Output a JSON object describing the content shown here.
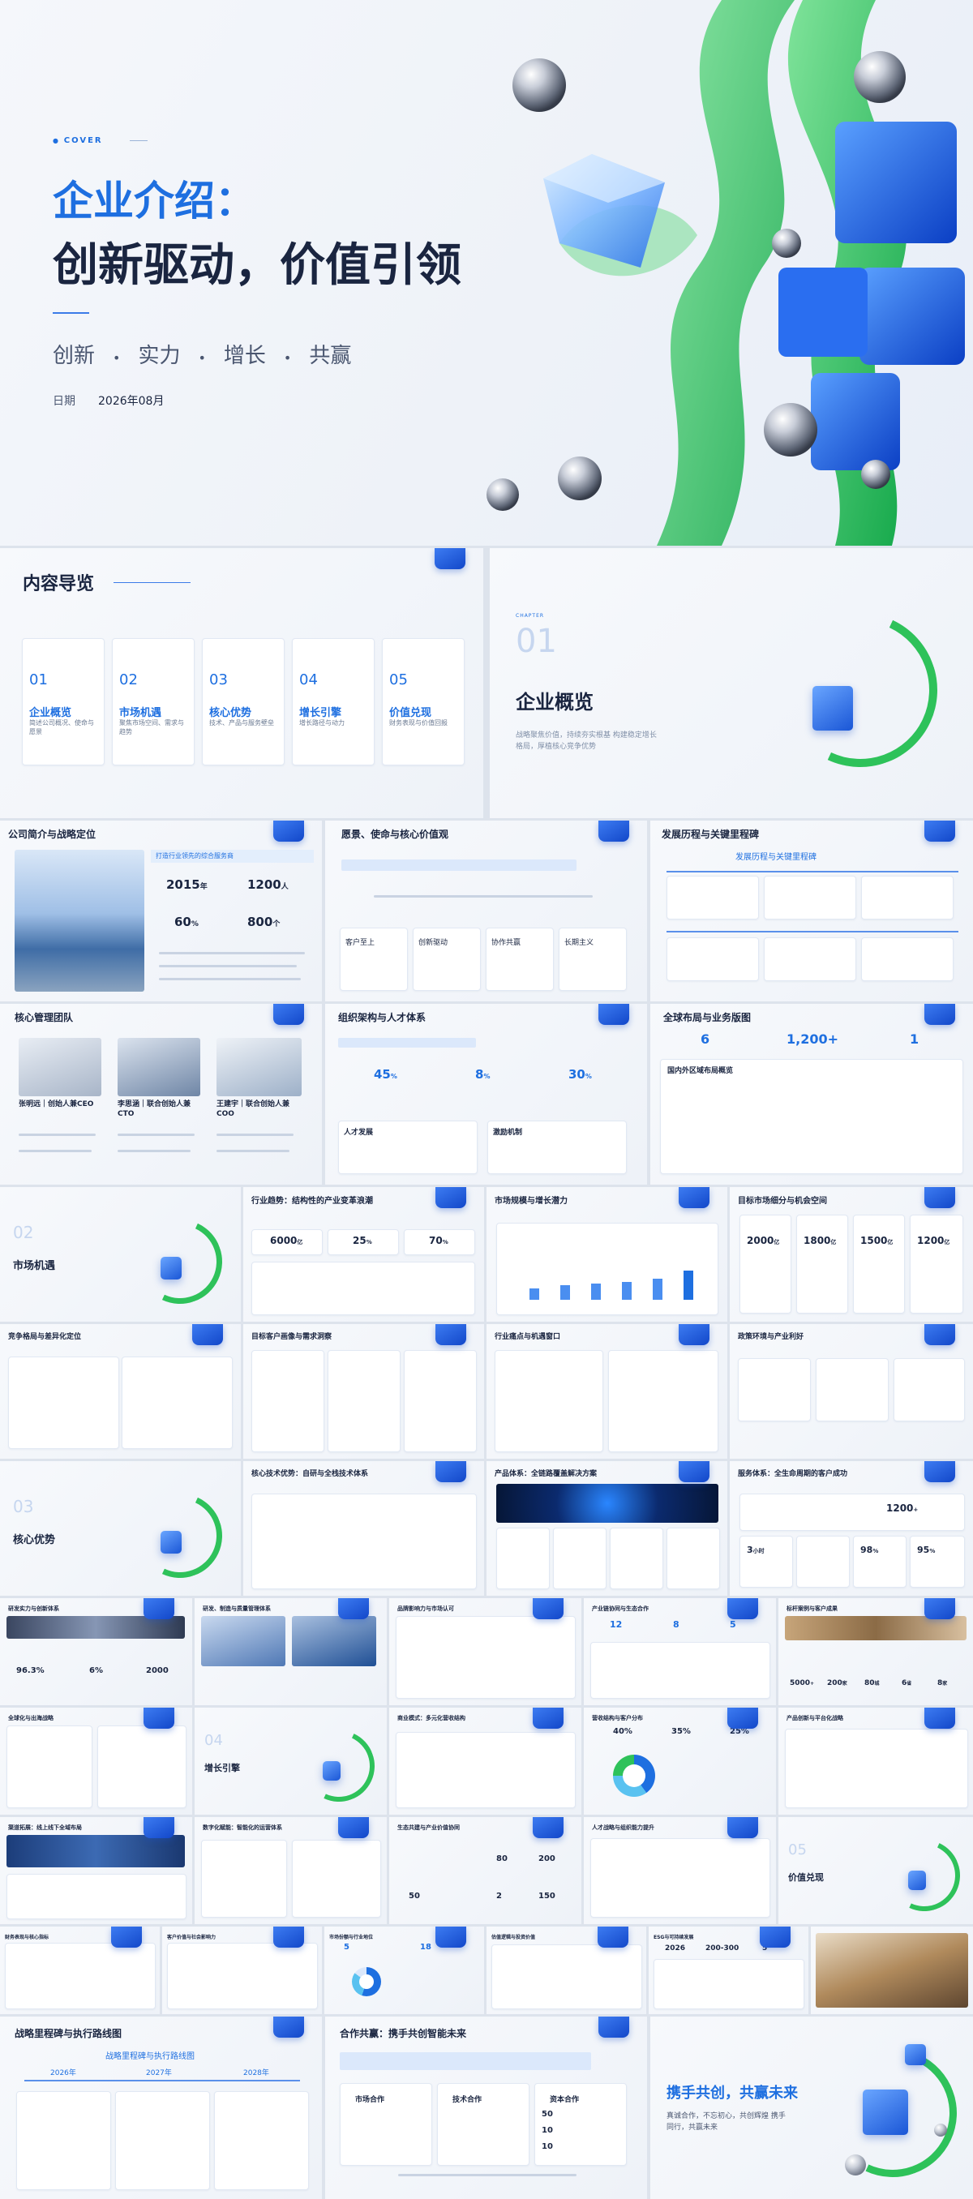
{
  "cover": {
    "tag": "COVER",
    "title_line1": "企业介绍：",
    "title_line2": "创新驱动，价值引领",
    "keywords": [
      "创新",
      "实力",
      "增长",
      "共赢"
    ],
    "separator": "•",
    "date_label": "日期",
    "date_value": "2026年08月"
  },
  "toc": {
    "title": "内容导览",
    "items": [
      {
        "num": "01",
        "title": "企业概览",
        "desc": "简述公司概况、使命与愿景"
      },
      {
        "num": "02",
        "title": "市场机遇",
        "desc": "聚焦市场空间、需求与趋势"
      },
      {
        "num": "03",
        "title": "核心优势",
        "desc": "技术、产品与服务壁垒"
      },
      {
        "num": "04",
        "title": "增长引擎",
        "desc": "增长路径与动力"
      },
      {
        "num": "05",
        "title": "价值兑现",
        "desc": "财务表现与价值回报"
      }
    ]
  },
  "chapter01": {
    "tag": "CHAPTER",
    "num": "01",
    "title": "企业概览",
    "desc": "战略聚焦价值，持续夯实根基 构建稳定增长格局，厚植核心竞争优势"
  },
  "row1": {
    "s1": {
      "title": "公司简介与战略定位",
      "banner": "打造行业领先的综合服务商",
      "stats": [
        {
          "v": "2015",
          "u": "年"
        },
        {
          "v": "1200",
          "u": "人"
        },
        {
          "v": "60",
          "u": "%"
        },
        {
          "v": "800",
          "u": "个"
        }
      ]
    },
    "s2": {
      "title": "愿景、使命与核心价值观",
      "values": [
        "客户至上",
        "创新驱动",
        "协作共赢",
        "长期主义"
      ]
    },
    "s3": {
      "title": "发展历程与关键里程碑",
      "subtitle": "发展历程与关键里程碑"
    }
  },
  "row2": {
    "s1": {
      "title": "核心管理团队",
      "people": [
        {
          "name": "张明远｜创始人兼CEO"
        },
        {
          "name": "李思涵｜联合创始人兼CTO"
        },
        {
          "name": "王建宇｜联合创始人兼COO"
        }
      ]
    },
    "s2": {
      "title": "组织架构与人才体系",
      "stats": [
        {
          "v": "45",
          "u": "%"
        },
        {
          "v": "8",
          "u": "%"
        },
        {
          "v": "30",
          "u": "%"
        }
      ],
      "sub": [
        "人才发展",
        "激励机制"
      ]
    },
    "s3": {
      "title": "全球布局与业务版图",
      "stats": [
        {
          "v": "6"
        },
        {
          "v": "1,200+"
        },
        {
          "v": "1"
        }
      ],
      "sub": "国内外区域布局概览"
    }
  },
  "chapter02": {
    "num": "02",
    "title": "市场机遇"
  },
  "row3": {
    "s2": {
      "title": "行业趋势：结构性的产业变革浪潮",
      "stats": [
        {
          "v": "6000",
          "u": "亿"
        },
        {
          "v": "25",
          "u": "%"
        },
        {
          "v": "70",
          "u": "%"
        }
      ]
    },
    "s3": {
      "title": "市场规模与增长潜力"
    },
    "s4": {
      "title": "目标市场细分与机会空间",
      "stats": [
        {
          "v": "2000",
          "u": "亿"
        },
        {
          "v": "1800",
          "u": "亿"
        },
        {
          "v": "1500",
          "u": "亿"
        },
        {
          "v": "1200",
          "u": "亿"
        }
      ]
    }
  },
  "row4": {
    "s1": {
      "title": "竞争格局与差异化定位"
    },
    "s2": {
      "title": "目标客户画像与需求洞察"
    },
    "s3": {
      "title": "行业痛点与机遇窗口"
    },
    "s4": {
      "title": "政策环境与产业利好"
    }
  },
  "chapter03": {
    "num": "03",
    "title": "核心优势"
  },
  "row5": {
    "s2": {
      "title": "核心技术优势：自研与全栈技术体系"
    },
    "s3": {
      "title": "产品体系：全链路覆盖解决方案"
    },
    "s4": {
      "title": "服务体系：全生命周期的客户成功",
      "stats": [
        {
          "v": "1200",
          "u": "+"
        },
        {
          "v": "3",
          "u": "小时"
        },
        {
          "v": "98",
          "u": "%"
        },
        {
          "v": "95",
          "u": "%"
        }
      ]
    }
  },
  "row6": {
    "titles": [
      "研发实力与创新体系",
      "研发、制造与质量管理体系",
      "品牌影响力与市场认可",
      "产业链协同与生态合作",
      "标杆案例与客户成果"
    ],
    "stats_a": [
      "96.3%",
      "6%",
      "2000"
    ],
    "stats_d": [
      "12",
      "8",
      "5"
    ],
    "stats_e": [
      "5000",
      "200",
      "80",
      "6",
      "8"
    ],
    "suffix_e": [
      "+",
      "家",
      "城",
      "省",
      "家"
    ]
  },
  "chapter04": {
    "num": "04",
    "title": "增长引擎"
  },
  "row7": {
    "titles": [
      "全球化与出海战略",
      "",
      "商业模式：多元化营收结构",
      "营收结构与客户分布",
      "产品创新与平台化战略"
    ],
    "stats_d": [
      "40%",
      "35%",
      "25%"
    ]
  },
  "row8": {
    "titles": [
      "渠道拓展：线上线下全域布局",
      "数字化赋能：智能化的运营体系",
      "生态共建与产业价值协同",
      "人才战略与组织能力提升"
    ],
    "stats_c": [
      "80",
      "200",
      "50",
      "2",
      "150"
    ],
    "chapter05": {
      "num": "05",
      "title": "价值兑现"
    }
  },
  "row9": {
    "titles": [
      "财务表现与核心指标",
      "客户价值与社会影响力",
      "市场份额与行业地位",
      "估值逻辑与投资价值",
      "ESG与可持续发展",
      ""
    ],
    "stats": [
      "5",
      "18",
      "2026",
      "200-300",
      "5"
    ]
  },
  "row10": {
    "s1": {
      "title": "战略里程碑与执行路线图",
      "subtitle": "战略里程碑与执行路线图",
      "years": [
        "2026年",
        "2027年",
        "2028年"
      ]
    },
    "s2": {
      "title": "合作共赢：携手共创智能未来",
      "boxes": [
        "市场合作",
        "技术合作",
        "资本合作"
      ],
      "stats": [
        "50",
        "10",
        "10"
      ]
    },
    "s3": {
      "title": "携手共创，共赢未来",
      "desc": "真诚合作，不忘初心，共创辉煌 携手同行，共赢未来"
    }
  },
  "colors": {
    "accent": "#1e6fe0",
    "green": "#2ec25a",
    "dark": "#1a2540"
  }
}
